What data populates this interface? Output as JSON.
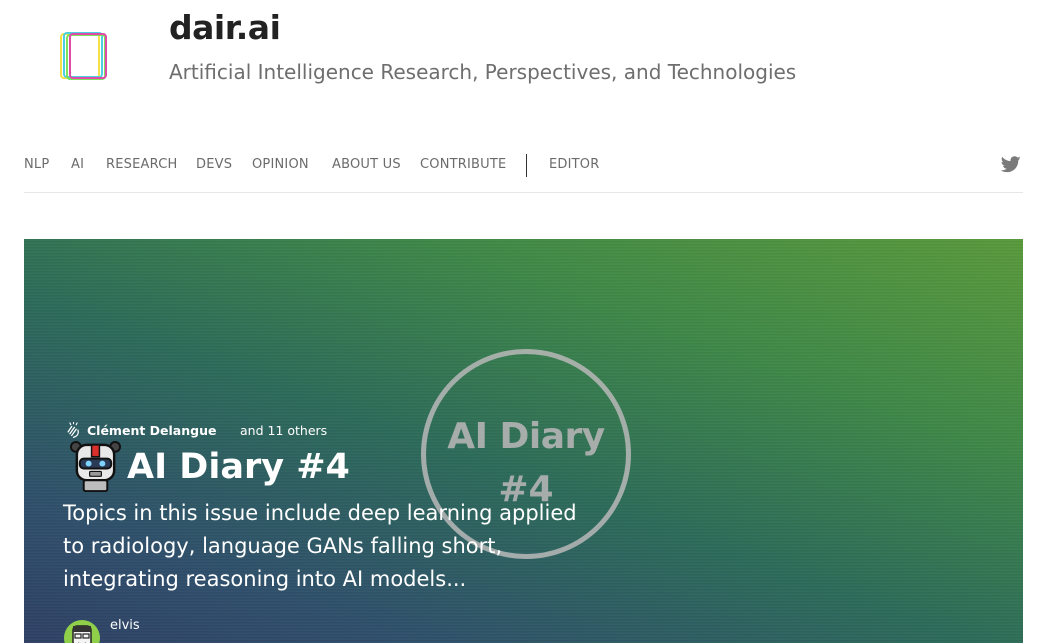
{
  "brand": {
    "title": "dair.ai",
    "tagline": "Artificial Intelligence Research, Perspectives, and Technologies"
  },
  "nav": {
    "items": [
      "NLP",
      "AI",
      "RESEARCH",
      "DEVS",
      "OPINION",
      "ABOUT US",
      "CONTRIBUTE"
    ],
    "editor": "EDITOR",
    "social_icon": "twitter-icon"
  },
  "hero": {
    "badge_line1": "AI Diary",
    "badge_line2": "#4",
    "clap_icon": "clap-icon",
    "recommender": "Clément Delangue",
    "recommender_others": "and 11 others",
    "post_icon": "robot-icon",
    "title": "AI Diary #4",
    "excerpt": "Topics in this issue include deep learning applied to radiology, language GANs falling short, integrating reasoning into AI models...",
    "author": "elvis"
  },
  "colors": {
    "gradient_top_right": "#5a9a3c",
    "gradient_bottom_left": "#2f4165",
    "nav_text": "#6b6b6b"
  }
}
